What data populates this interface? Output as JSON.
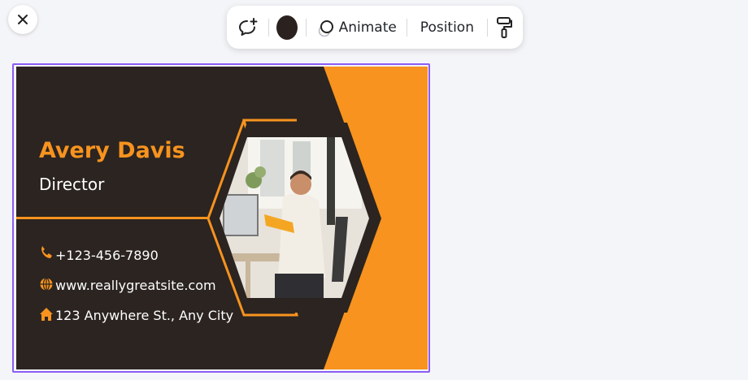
{
  "toolbar": {
    "animate_label": "Animate",
    "position_label": "Position"
  },
  "card": {
    "name": "Avery Davis",
    "title": "Director",
    "phone": "+123-456-7890",
    "website": "www.reallygreatsite.com",
    "address": "123 Anywhere St., Any City"
  },
  "colors": {
    "accent": "#f7931e",
    "card_bg": "#2b2421",
    "selection": "#8b5cf6",
    "color_swatch": "#2b2220"
  },
  "icons": {
    "close": "close-icon",
    "comment": "add-comment-icon",
    "animate": "animate-icon",
    "format": "paint-roller-icon",
    "phone": "phone-icon",
    "web": "globe-icon",
    "address": "home-icon"
  }
}
